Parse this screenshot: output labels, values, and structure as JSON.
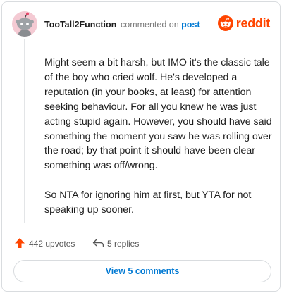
{
  "comment": {
    "username": "TooTall2Function",
    "meta_prefix": "commented on",
    "meta_link": "post",
    "paragraphs": [
      "Might seem a bit harsh, but IMO it's the classic tale of the boy who cried wolf. He's developed a reputation (in your books, at least) for attention seeking behaviour. For all you knew he was just acting stupid again. However, you should have said something the moment you saw he was rolling over the road; by that point it should have been clear something was off/wrong.",
      "So NTA for ignoring him at first, but YTA for not speaking up sooner."
    ],
    "upvotes": "442 upvotes",
    "replies": "5 replies",
    "view_comments": "View 5 comments"
  },
  "brand": {
    "name": "reddit",
    "color": "#ff4500"
  },
  "icons": {
    "avatar": "snoo-avatar",
    "logo": "reddit-snoo-icon",
    "upvote": "upvote-arrow-icon",
    "reply": "reply-arrow-icon"
  },
  "colors": {
    "accent": "#0079d3",
    "upvote": "#ff4500",
    "avatar_bg": "#f4cad3"
  }
}
